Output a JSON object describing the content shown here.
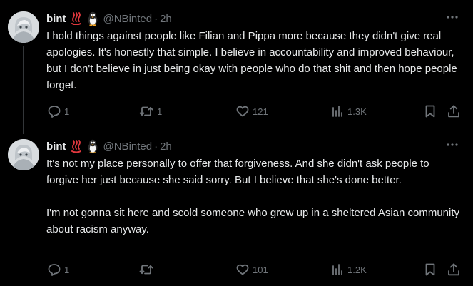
{
  "tweets": [
    {
      "name": "bint",
      "emoji1": "hot-springs-emoji",
      "emoji2": "penguin-emoji",
      "handle": "@NBinted",
      "dot": "·",
      "time": "2h",
      "text": "I hold things against people like Filian and Pippa more because they didn't give real apologies. It's honestly that simple. I believe in accountability and improved behaviour, but I don't believe in just being okay with people who do that shit and then hope people forget.",
      "replies": "1",
      "reposts": "1",
      "likes": "121",
      "views": "1.3K"
    },
    {
      "name": "bint",
      "emoji1": "hot-springs-emoji",
      "emoji2": "penguin-emoji",
      "handle": "@NBinted",
      "dot": "·",
      "time": "2h",
      "text": "It's not my place personally to offer that forgiveness. And she didn't ask people to forgive her just because she said sorry. But I believe that she's done better.\n\nI'm not gonna sit here and scold someone who grew up in a sheltered Asian community about racism anyway.",
      "replies": "1",
      "reposts": "",
      "likes": "101",
      "views": "1.2K"
    }
  ],
  "colors": {
    "background": "#000000",
    "text": "#e7e9ea",
    "secondary": "#71767b",
    "emoji_red": "#e0383e"
  }
}
